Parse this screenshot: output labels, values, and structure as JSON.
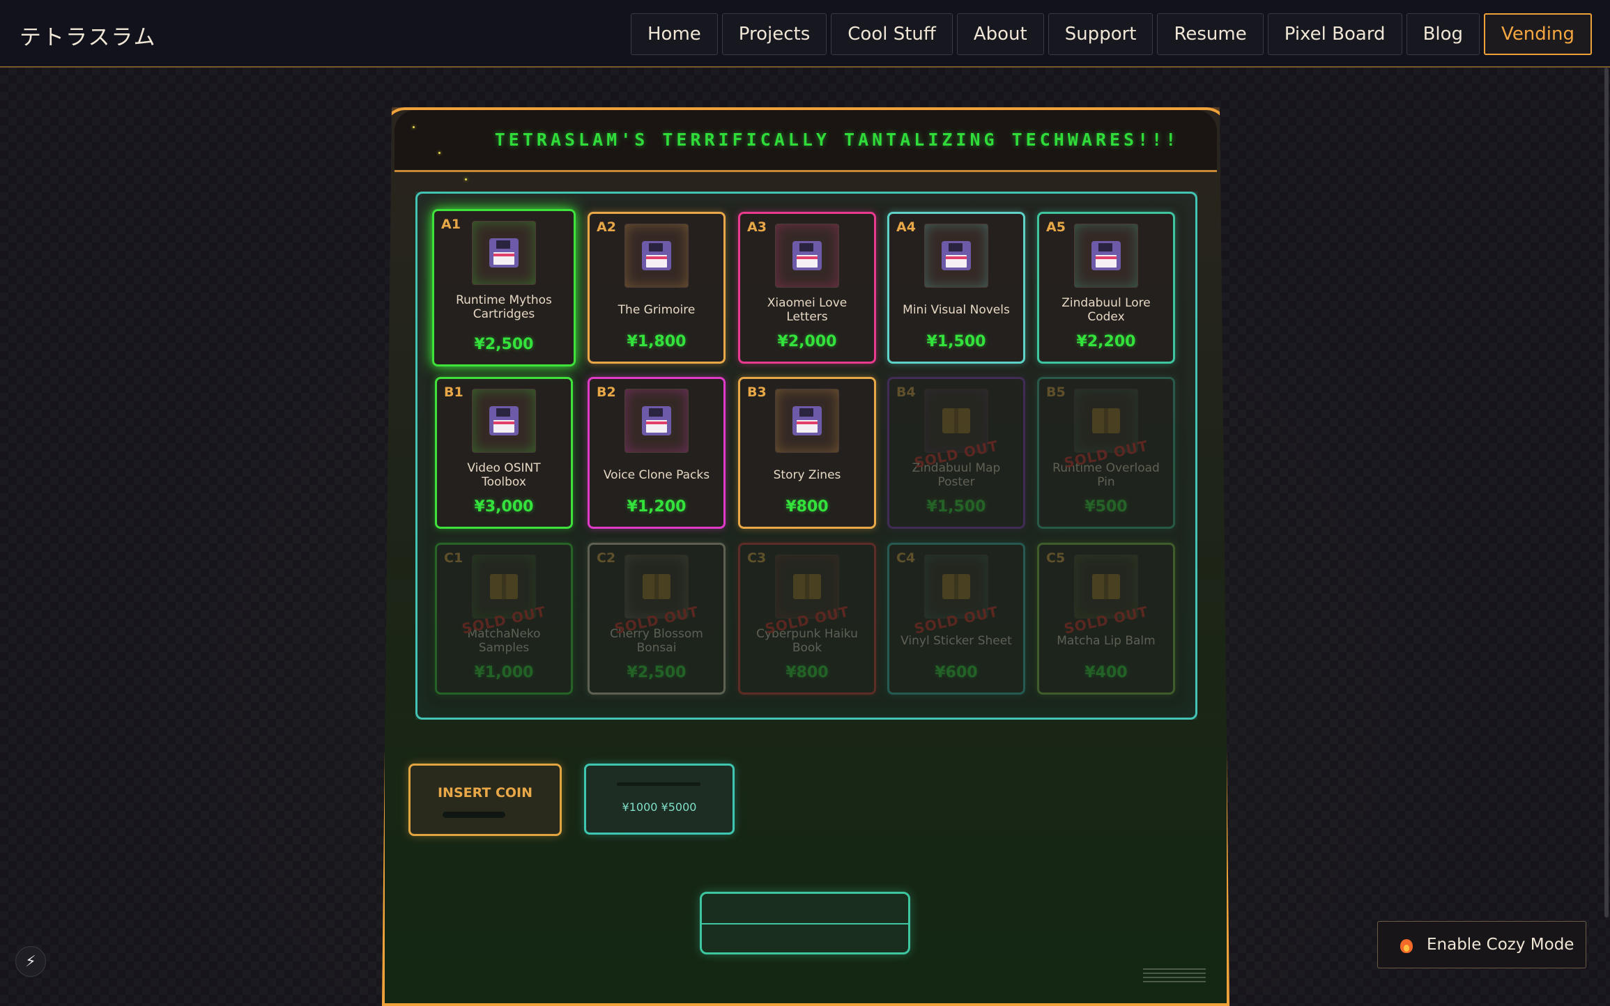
{
  "header": {
    "brand": "テトラスラム",
    "nav": [
      "Home",
      "Projects",
      "Cool Stuff",
      "About",
      "Support",
      "Resume",
      "Pixel Board",
      "Blog",
      "Vending"
    ],
    "active_nav": "Vending"
  },
  "machine": {
    "marquee": "TETRASLAM'S TERRIFICALLY TANTALIZING TECHWARES!!!",
    "sold_out_label": "SOLD OUT",
    "insert_coin_label": "INSERT COIN",
    "bill_label": "¥1000 ¥5000",
    "slots": [
      {
        "code": "A1",
        "name": "Runtime Mythos Cartridges",
        "price": "¥2,500",
        "icon": "floppy-disk-icon",
        "color": "#3ee23a",
        "sold_out": false,
        "selected": true
      },
      {
        "code": "A2",
        "name": "The Grimoire",
        "price": "¥1,800",
        "icon": "floppy-disk-icon",
        "color": "#e8a848",
        "sold_out": false
      },
      {
        "code": "A3",
        "name": "Xiaomei Love Letters",
        "price": "¥2,000",
        "icon": "floppy-disk-icon",
        "color": "#e83a8e",
        "sold_out": false
      },
      {
        "code": "A4",
        "name": "Mini Visual Novels",
        "price": "¥1,500",
        "icon": "floppy-disk-icon",
        "color": "#5ed2c6",
        "sold_out": false
      },
      {
        "code": "A5",
        "name": "Zindabuul Lore Codex",
        "price": "¥2,200",
        "icon": "floppy-disk-icon",
        "color": "#3ec6a0",
        "sold_out": false
      },
      {
        "code": "B1",
        "name": "Video OSINT Toolbox",
        "price": "¥3,000",
        "icon": "floppy-disk-icon",
        "color": "#3ee23a",
        "sold_out": false
      },
      {
        "code": "B2",
        "name": "Voice Clone Packs",
        "price": "¥1,200",
        "icon": "floppy-disk-icon",
        "color": "#e03ac8",
        "sold_out": false
      },
      {
        "code": "B3",
        "name": "Story Zines",
        "price": "¥800",
        "icon": "floppy-disk-icon",
        "color": "#e8a848",
        "sold_out": false
      },
      {
        "code": "B4",
        "name": "Zindabuul Map Poster",
        "price": "¥1,500",
        "icon": "box-icon",
        "color": "#8a3ac8",
        "sold_out": true
      },
      {
        "code": "B5",
        "name": "Runtime Overload Pin",
        "price": "¥500",
        "icon": "box-icon",
        "color": "#3ec6a0",
        "sold_out": true
      },
      {
        "code": "C1",
        "name": "MatchaNeko Samples",
        "price": "¥1,000",
        "icon": "box-icon",
        "color": "#3ee23a",
        "sold_out": true
      },
      {
        "code": "C2",
        "name": "Cherry Blossom Bonsai",
        "price": "¥2,500",
        "icon": "box-icon",
        "color": "#e8dcc0",
        "sold_out": true
      },
      {
        "code": "C3",
        "name": "Cyberpunk Haiku Book",
        "price": "¥800",
        "icon": "box-icon",
        "color": "#e83a3a",
        "sold_out": true
      },
      {
        "code": "C4",
        "name": "Vinyl Sticker Sheet",
        "price": "¥600",
        "icon": "box-icon",
        "color": "#3ec6c0",
        "sold_out": true
      },
      {
        "code": "C5",
        "name": "Matcha Lip Balm",
        "price": "¥400",
        "icon": "box-icon",
        "color": "#8ad24a",
        "sold_out": true
      }
    ]
  },
  "cozy_button": "Enable Cozy Mode",
  "colors": {
    "accent": "#f0a23a",
    "neon_green": "#34e23c",
    "glass": "#43c4b4"
  }
}
